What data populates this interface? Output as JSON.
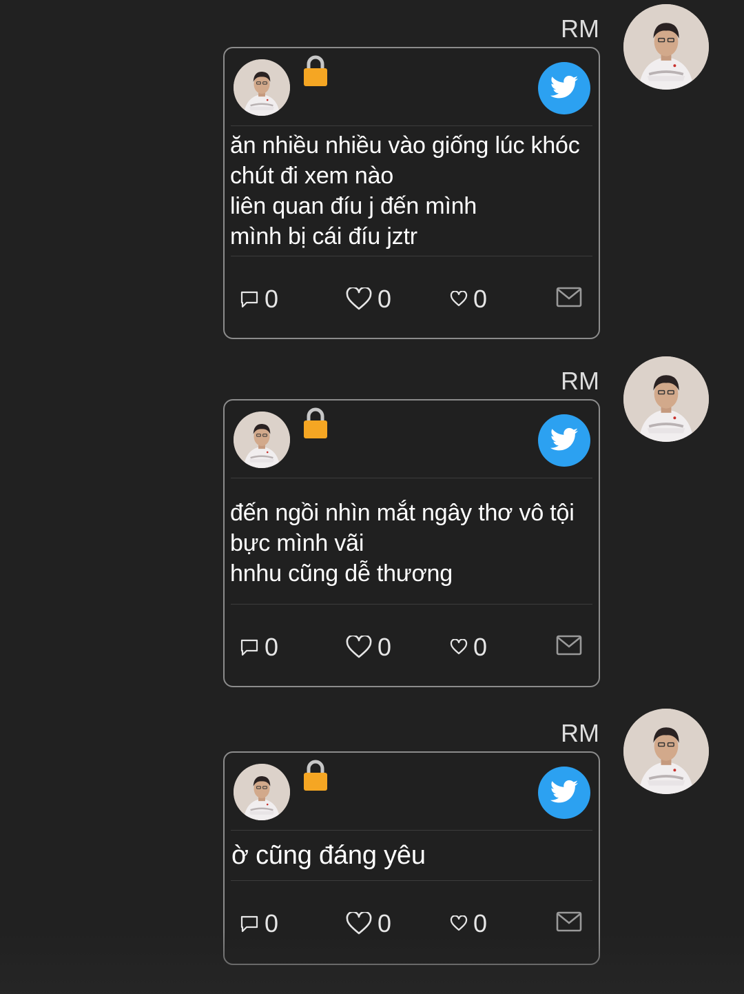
{
  "messages": [
    {
      "sender": "RM",
      "text": "ăn nhiều nhiều vào giống lúc khóc\nchút đi xem nào\nliên quan đíu j đến mình\nmình bị cái đíu jztr",
      "replies": "0",
      "likes": "0",
      "hearts": "0"
    },
    {
      "sender": "RM",
      "text": "đến ngồi nhìn mắt ngây thơ vô tội\nbực mình vãi\nhnhu cũng dễ thương",
      "replies": "0",
      "likes": "0",
      "hearts": "0"
    },
    {
      "sender": "RM",
      "text": "ờ cũng đáng yêu",
      "replies": "0",
      "likes": "0",
      "hearts": "0"
    }
  ],
  "icons": {
    "lock": "lock-icon",
    "bird": "twitter-bird-icon",
    "reply": "comment-icon",
    "like": "heart-icon",
    "heart_small": "small-heart-icon",
    "mail": "mail-icon"
  },
  "colors": {
    "background": "#212121",
    "card_border": "#8c8c8c",
    "twitter_blue": "#2ca1f1",
    "lock_orange": "#f5a623"
  }
}
